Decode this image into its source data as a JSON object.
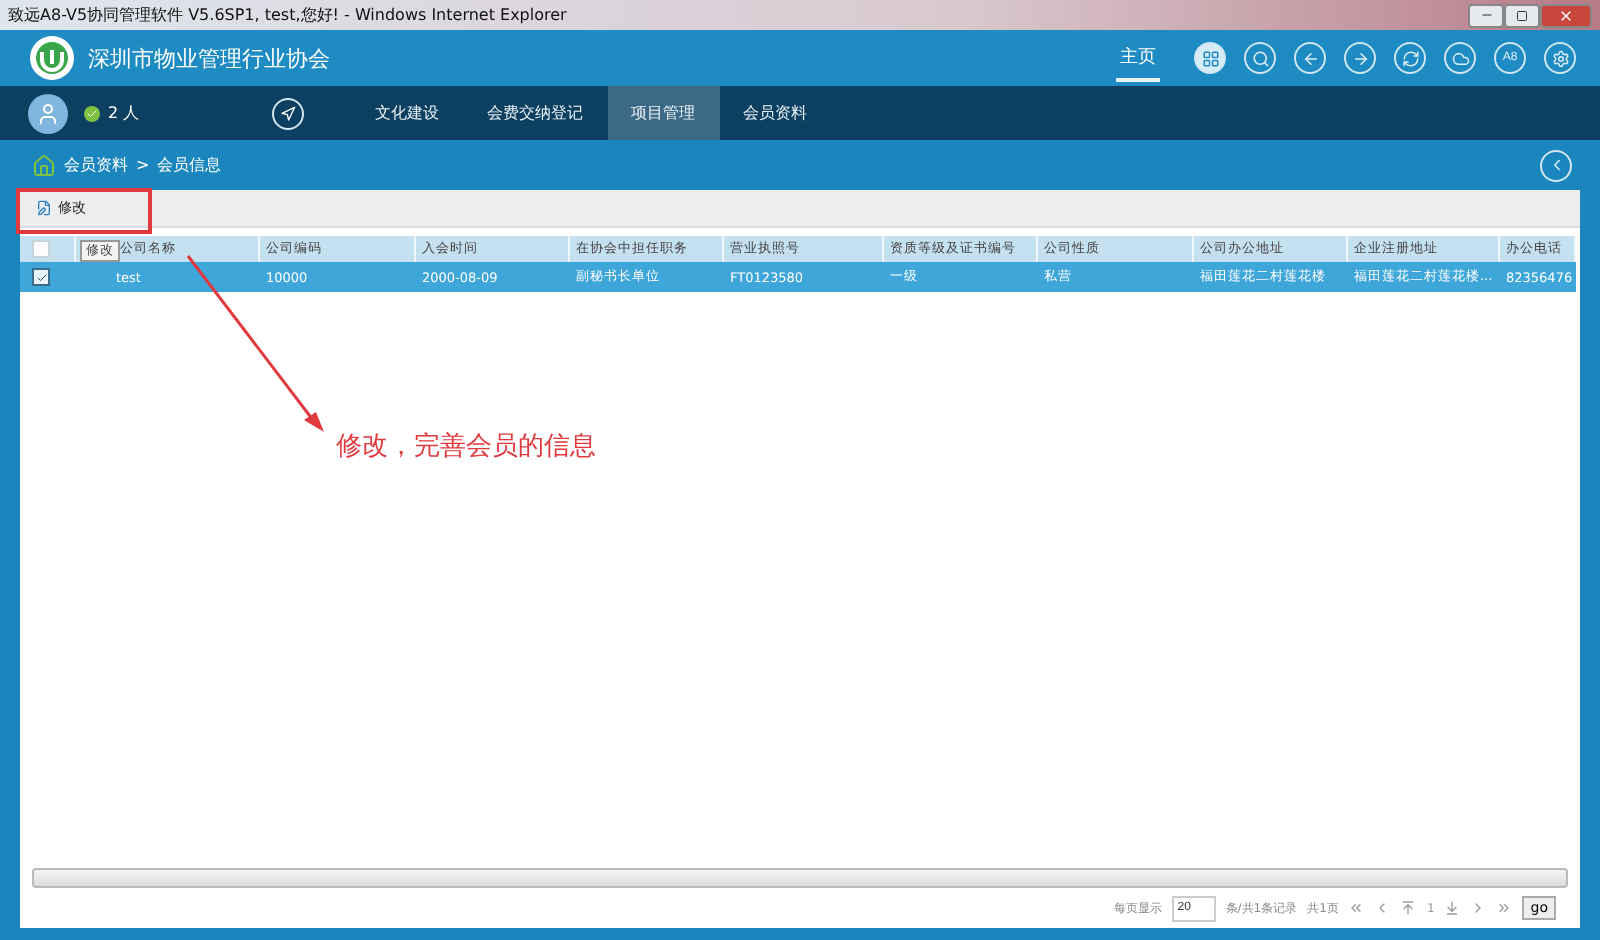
{
  "window": {
    "title": "致远A8-V5协同管理软件 V5.6SP1, test,您好! - Windows Internet Explorer"
  },
  "header": {
    "org_name": "深圳市物业管理行业协会",
    "home_link": {
      "label": "主页",
      "selected": true
    },
    "icon_button_label": "A8"
  },
  "nav": {
    "online_count": "2 人",
    "items": [
      {
        "label": "文化建设",
        "selected": false
      },
      {
        "label": "会费交纳登记",
        "selected": false
      },
      {
        "label": "项目管理",
        "selected": true
      },
      {
        "label": "会员资料",
        "selected": false
      }
    ]
  },
  "breadcrumb": [
    "会员资料",
    "会员信息"
  ],
  "breadcrumb_separator": ">",
  "toolbar": {
    "buttons": [
      "修改"
    ]
  },
  "tooltip": "修改",
  "table": {
    "header_checked": false,
    "columns": [
      "公司名称",
      "公司编码",
      "入会时间",
      "在协会中担任职务",
      "营业执照号",
      "资质等级及证书编号",
      "公司性质",
      "公司办公地址",
      "企业注册地址",
      "办公电话"
    ],
    "rows": [
      {
        "checked": true,
        "selected": true,
        "cells": [
          "test",
          "10000",
          "2000-08-09",
          "副秘书长单位",
          "FT0123580",
          "一级",
          "私营",
          "福田莲花二村莲花楼",
          "福田莲花二村莲花楼...",
          "82356476"
        ]
      }
    ]
  },
  "pager": {
    "per_page_label": "每页显示",
    "per_page": "20",
    "record_info": "条/共1条记录",
    "page_info": "共1页",
    "current_page": "1",
    "go": "go"
  },
  "annotation": {
    "text": "修改，完善会员的信息"
  }
}
